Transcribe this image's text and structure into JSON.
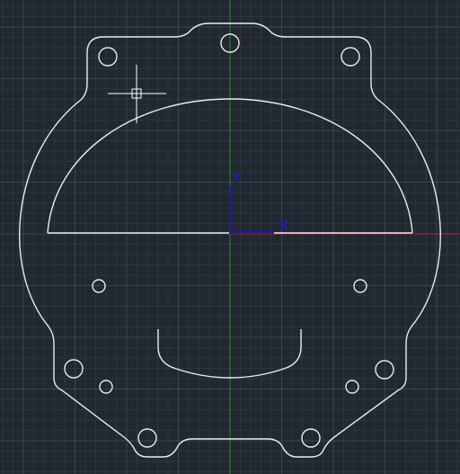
{
  "app": {
    "type": "cad-model-space-viewport"
  },
  "colors": {
    "background": "#212830",
    "grid_minor": "#2c3540",
    "grid_major": "#3a4450",
    "geometry": "#e8ecef",
    "x_axis_line": "#b8262b",
    "y_axis_line": "#2f8a35",
    "ucs_icon": "#1c20a8",
    "crosshair": "#ffffff"
  },
  "ucs": {
    "x_label": "X",
    "y_label": "Y"
  },
  "icons": {
    "ucs": "ucs-icon",
    "cursor": "crosshair-pickbox-icon"
  }
}
